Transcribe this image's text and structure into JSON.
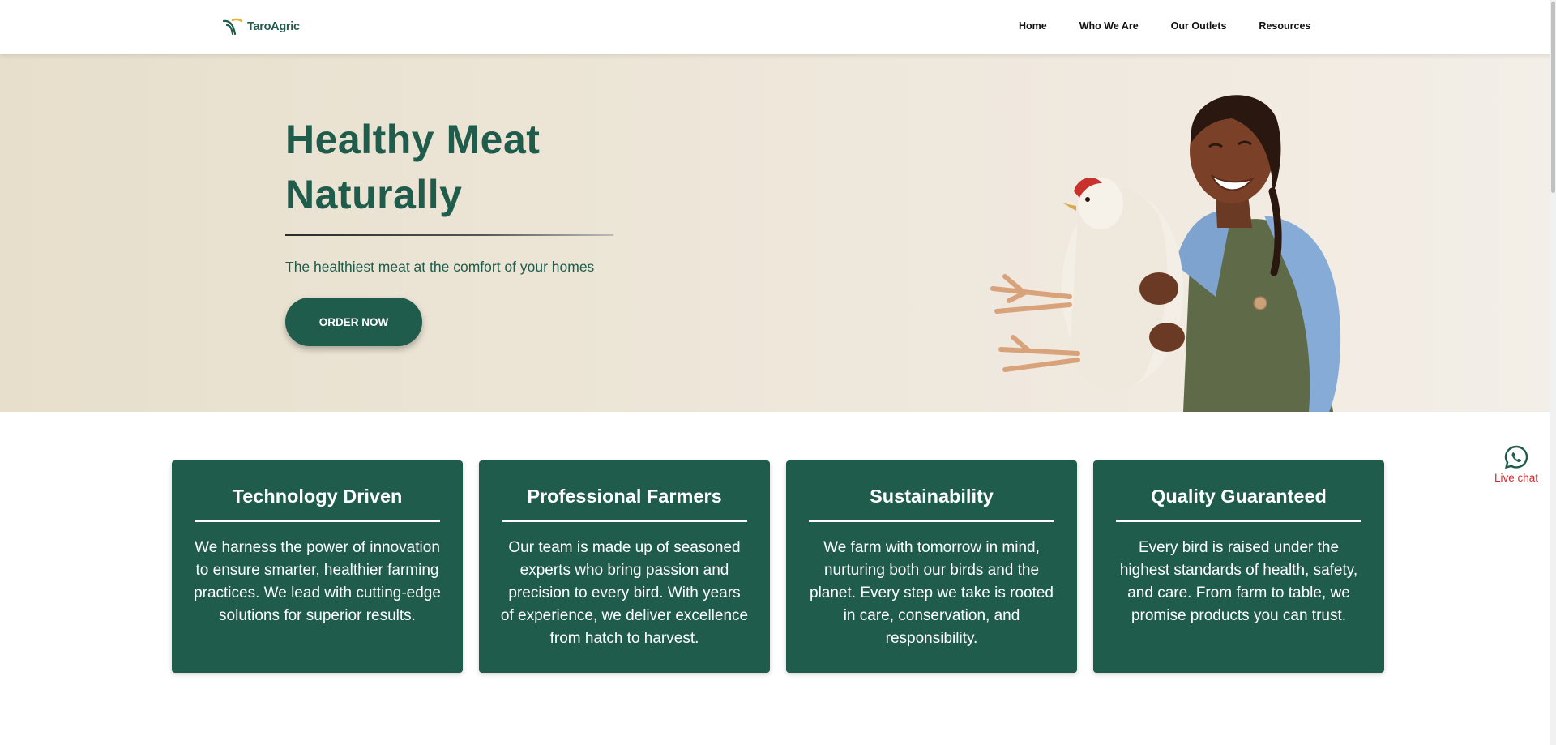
{
  "brand": {
    "name": "TaroAgric",
    "color": "#1f5c4c",
    "accent": "#e0b53a"
  },
  "nav": {
    "items": [
      {
        "label": "Home"
      },
      {
        "label": "Who We Are"
      },
      {
        "label": "Our Outlets"
      },
      {
        "label": "Resources"
      }
    ]
  },
  "hero": {
    "title_line1": "Healthy Meat",
    "title_line2": "Naturally",
    "subtitle": "The healthiest meat at the comfort of your homes",
    "cta_label": "ORDER NOW"
  },
  "features": [
    {
      "title": "Technology Driven",
      "text": "We harness the power of innovation to ensure smarter, healthier farming practices. We lead with cutting-edge solutions for superior results."
    },
    {
      "title": "Professional Farmers",
      "text": "Our team is made up of seasoned experts who bring passion and precision to every bird. With years of experience, we deliver excellence from hatch to harvest."
    },
    {
      "title": "Sustainability",
      "text": "We farm with tomorrow in mind, nurturing both our birds and the planet. Every step we take is rooted in care, conservation, and responsibility."
    },
    {
      "title": "Quality Guaranteed",
      "text": "Every bird is raised under the highest standards of health, safety, and care. From farm to table, we promise products you can trust."
    }
  ],
  "live_chat": {
    "label": "Live chat",
    "icon": "whatsapp-icon",
    "label_color": "#d32f2f"
  }
}
